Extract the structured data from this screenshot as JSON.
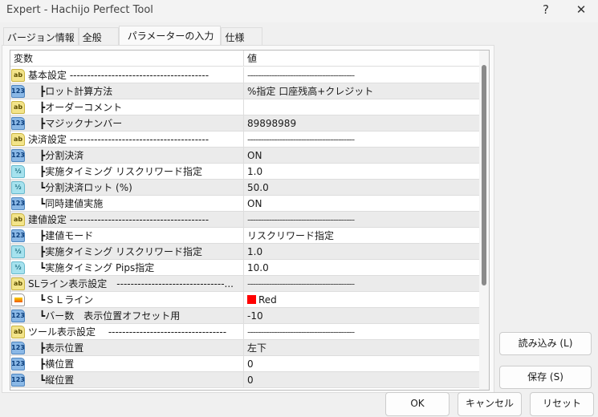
{
  "window": {
    "title": "Expert - Hachijo Perfect Tool",
    "help": "?",
    "close": "✕"
  },
  "tabs": [
    "バージョン情報",
    "全般",
    "パラメーターの入力",
    "仕様"
  ],
  "table": {
    "headers": [
      "変数",
      "値"
    ],
    "rows": [
      {
        "type": "ab",
        "name": "基本設定 ----------------------------------------",
        "value": "----------------------------------------",
        "group": true
      },
      {
        "type": "123",
        "name": "┣ロット計算方法",
        "value": "%指定 口座残高+クレジット"
      },
      {
        "type": "ab",
        "name": "┣オーダーコメント",
        "value": ""
      },
      {
        "type": "123",
        "name": "┣マジックナンバー",
        "value": "89898989"
      },
      {
        "type": "ab",
        "name": "決済設定 ----------------------------------------",
        "value": "----------------------------------------",
        "group": true
      },
      {
        "type": "123",
        "name": "┣分割決済",
        "value": "ON"
      },
      {
        "type": "half",
        "name": "┣実施タイミング リスクリワード指定",
        "value": "1.0"
      },
      {
        "type": "half",
        "name": "┗分割決済ロット (%)",
        "value": "50.0"
      },
      {
        "type": "123",
        "name": "┗同時建値実施",
        "value": "ON"
      },
      {
        "type": "ab",
        "name": "建値設定 ----------------------------------------",
        "value": "----------------------------------------",
        "group": true
      },
      {
        "type": "123",
        "name": "┣建値モード",
        "value": "リスクリワード指定"
      },
      {
        "type": "half",
        "name": "┣実施タイミング リスクリワード指定",
        "value": "1.0"
      },
      {
        "type": "half",
        "name": "┗実施タイミング Pips指定",
        "value": "10.0"
      },
      {
        "type": "ab",
        "name": "SLライン表示設定　-------------------------------...",
        "value": "----------------------------------------",
        "group": true
      },
      {
        "type": "color",
        "name": "┗ＳＬライン",
        "value": "Red",
        "swatch": "#ff0000"
      },
      {
        "type": "123",
        "name": "┗バー数　表示位置オフセット用",
        "value": "-10"
      },
      {
        "type": "ab",
        "name": "ツール表示設定　 ----------------------------------",
        "value": "----------------------------------------",
        "group": true
      },
      {
        "type": "123",
        "name": "┣表示位置",
        "value": "左下"
      },
      {
        "type": "123",
        "name": "┣横位置",
        "value": "0"
      },
      {
        "type": "123",
        "name": "┗縦位置",
        "value": "0"
      }
    ]
  },
  "icons": {
    "ab": "ab",
    "123": "123",
    "half": "½"
  },
  "buttons": {
    "load": "読み込み (L)",
    "save": "保存 (S)",
    "ok": "OK",
    "cancel": "キャンセル",
    "reset": "リセット"
  }
}
